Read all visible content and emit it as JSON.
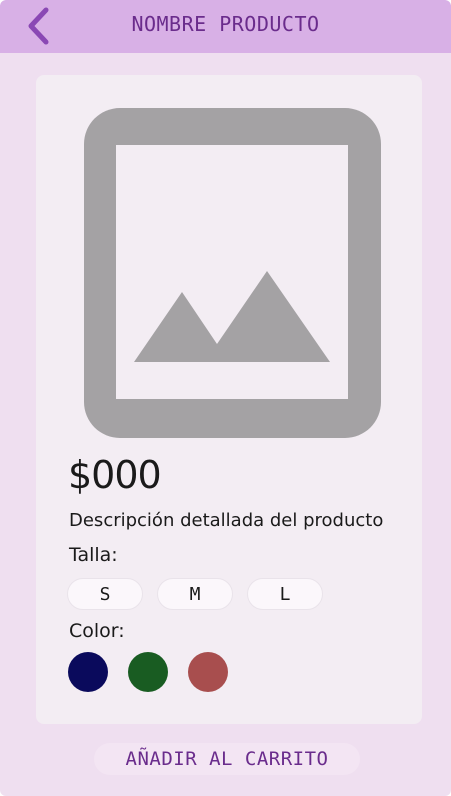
{
  "header": {
    "title": "NOMBRE PRODUCTO",
    "back_icon": "chevron-left-icon"
  },
  "product": {
    "image_icon": "image-placeholder-icon",
    "price": "$000",
    "description": "Descripción detallada del producto"
  },
  "size": {
    "label": "Talla:",
    "options": [
      "S",
      "M",
      "L"
    ]
  },
  "color": {
    "label": "Color:",
    "options": [
      "#0a0a5c",
      "#195c22",
      "#a84e4e"
    ]
  },
  "actions": {
    "add_to_cart_label": "AÑADIR AL CARRITO"
  },
  "colors": {
    "header_bg": "#d8b0e6",
    "accent": "#6a2c8c",
    "screen_bg": "#efdff0",
    "card_bg": "#f3edf3",
    "placeholder_gray": "#a4a2a4"
  }
}
